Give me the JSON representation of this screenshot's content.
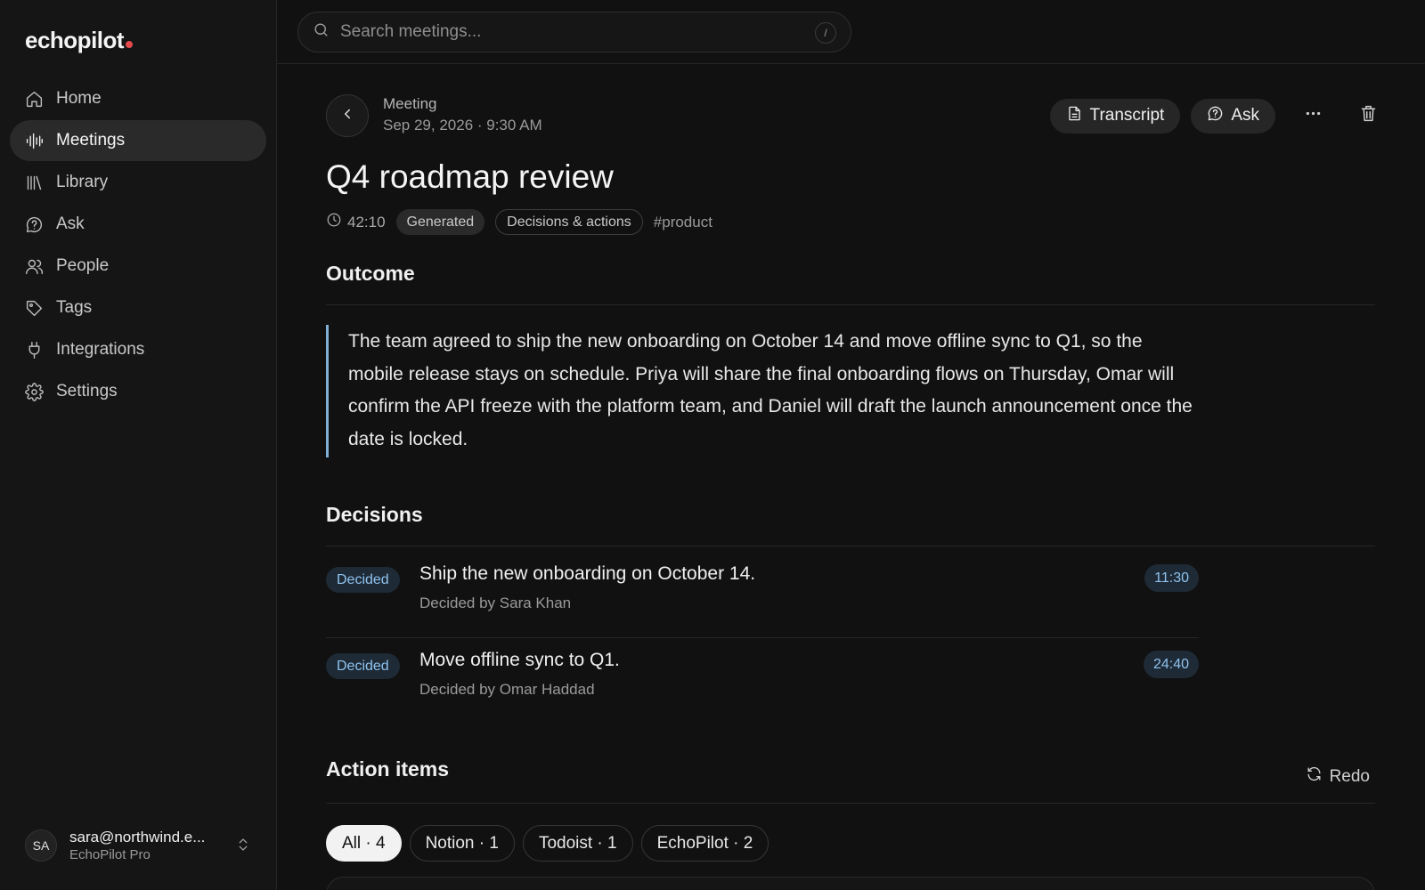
{
  "app": {
    "logo": "echopilot"
  },
  "sidebar": {
    "items": [
      {
        "label": "Home",
        "icon": "home-icon"
      },
      {
        "label": "Meetings",
        "icon": "waveform-icon",
        "active": true
      },
      {
        "label": "Library",
        "icon": "library-icon"
      },
      {
        "label": "Ask",
        "icon": "question-bubble-icon"
      },
      {
        "label": "People",
        "icon": "people-icon"
      },
      {
        "label": "Tags",
        "icon": "tag-icon"
      },
      {
        "label": "Integrations",
        "icon": "plug-icon"
      },
      {
        "label": "Settings",
        "icon": "gear-icon"
      }
    ],
    "account": {
      "initials": "SA",
      "email": "sara@northwind.e...",
      "plan": "EchoPilot Pro"
    }
  },
  "search": {
    "placeholder": "Search meetings...",
    "shortcut": "/"
  },
  "header": {
    "crumb_label": "Meeting",
    "date": "Sep 29, 2026 · 9:30 AM",
    "transcript_label": "Transcript",
    "ask_label": "Ask"
  },
  "meeting": {
    "title": "Q4 roadmap review",
    "duration": "42:10",
    "status_tag": "Generated",
    "template_tag": "Decisions & actions",
    "hashtag": "#product"
  },
  "outcome": {
    "heading": "Outcome",
    "text": "The team agreed to ship the new onboarding on October 14 and move offline sync to Q1, so the mobile release stays on schedule. Priya will share the final onboarding flows on Thursday, Omar will confirm the API freeze with the platform team, and Daniel will draft the launch announcement once the date is locked."
  },
  "decisions": {
    "heading": "Decisions",
    "items": [
      {
        "badge": "Decided",
        "text": "Ship the new onboarding on October 14.",
        "by": "Decided by Sara Khan",
        "timestamp": "11:30"
      },
      {
        "badge": "Decided",
        "text": "Move offline sync to Q1.",
        "by": "Decided by Omar Haddad",
        "timestamp": "24:40"
      }
    ]
  },
  "action_items": {
    "heading": "Action items",
    "redo_label": "Redo",
    "filters": [
      {
        "label": "All · 4",
        "active": true
      },
      {
        "label": "Notion · 1"
      },
      {
        "label": "Todoist · 1"
      },
      {
        "label": "EchoPilot · 2"
      }
    ]
  },
  "colors": {
    "accent": "#8fc3ee",
    "logo_dot": "#e5484d",
    "quote_border": "#7fb0d8",
    "background": "#111111"
  }
}
